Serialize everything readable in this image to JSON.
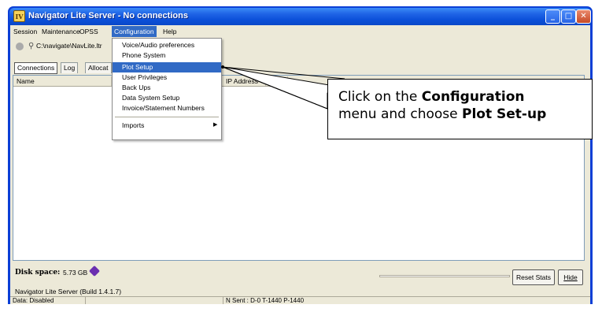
{
  "window": {
    "title": "Navigator Lite Server - No connections",
    "app_icon_text": "IV",
    "min_glyph": "_",
    "max_glyph": "□",
    "close_glyph": "✕"
  },
  "menubar": {
    "items": [
      "Session",
      "Maintenance",
      "OPSS",
      "Configuration",
      "Help"
    ]
  },
  "path": {
    "text": "C:\\navigate\\NavLite.ltr"
  },
  "tabs": [
    "Connections",
    "Log",
    "Allocat"
  ],
  "list": {
    "columns": [
      "Name",
      "IP Address",
      ""
    ]
  },
  "configuration_menu": {
    "items": [
      "Voice/Audio preferences",
      "Phone System",
      "Plot Setup",
      "User Privileges",
      "Back Ups",
      "Data System Setup",
      "Invoice/Statement Numbers",
      "Imports"
    ],
    "selected": "Plot Setup"
  },
  "callout": {
    "part1": "Click on the ",
    "bold1": "Configuration",
    "part2": " menu and choose ",
    "bold2": "Plot Set-up"
  },
  "bottom": {
    "disk_label": "Disk space:",
    "disk_value": "5.73 GB",
    "reset_label": "Reset Stats",
    "hide_label": "Hide",
    "build": "Navigator Lite Server (Build 1.4.1.7)"
  },
  "status": {
    "data": "Data: Disabled",
    "sent": "N Sent : D-0 T-1440 P-1440"
  },
  "colors": {
    "titlebar": "#0b4fd8",
    "selection": "#316ac5",
    "face": "#ece9d8"
  }
}
